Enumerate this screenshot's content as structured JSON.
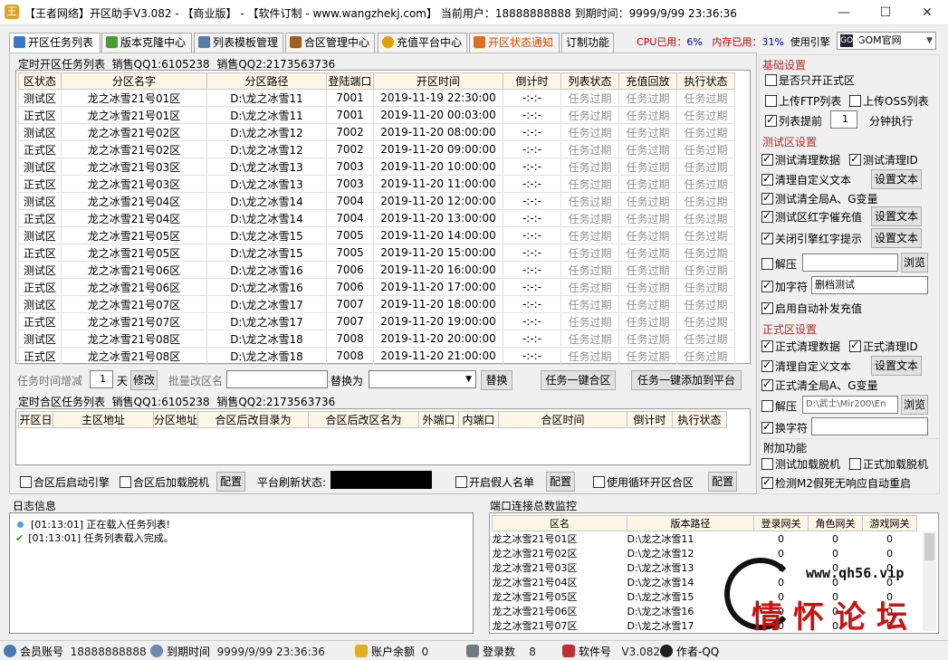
{
  "window": {
    "title": "【王者网络】开区助手V3.082 - 【商业版】 - 【软件订制 - www.wangzhekj.com】 当前用户：18888888888  到期时间：9999/9/99 23:36:36",
    "min": "—",
    "max": "☐",
    "close": "✕"
  },
  "tabs": [
    {
      "label": "开区任务列表",
      "icon": "calendar-icon",
      "color": "#3a78c8"
    },
    {
      "label": "版本克隆中心",
      "icon": "clone-icon",
      "color": "#4a9a3a"
    },
    {
      "label": "列表模板管理",
      "icon": "list-icon",
      "color": "#5a7aa8"
    },
    {
      "label": "合区管理中心",
      "icon": "merge-icon",
      "color": "#a06020"
    },
    {
      "label": "充值平台中心",
      "icon": "coin-icon",
      "color": "#e0a000"
    },
    {
      "label": "开区状态通知",
      "icon": "notify-icon",
      "color": "#e07020"
    },
    {
      "label": "订制功能",
      "icon": "",
      "color": ""
    }
  ],
  "topright": {
    "cpu_label": "CPU已用：",
    "cpu": "6%",
    "mem_label": "内存已用：",
    "mem": "31%",
    "engine_label": "使用引擎",
    "engine": "GOM官网",
    "engine_icon": "GOM"
  },
  "task": {
    "group": "定时开区任务列表",
    "qq1": "销售QQ1:6105238",
    "qq2": "销售QQ2:2173563736",
    "headers": [
      "区状态",
      "分区名字",
      "分区路径",
      "登陆端口",
      "开区时间",
      "倒计时",
      "列表状态",
      "充值回放",
      "执行状态"
    ],
    "rows": [
      [
        "测试区",
        "龙之冰雪21号01区",
        "D:\\龙之冰雪11",
        "7001",
        "2019-11-19 22:30:00",
        "-:-:-",
        "任务过期",
        "任务过期",
        "任务过期"
      ],
      [
        "正式区",
        "龙之冰雪21号01区",
        "D:\\龙之冰雪11",
        "7001",
        "2019-11-20 00:03:00",
        "-:-:-",
        "任务过期",
        "任务过期",
        "任务过期"
      ],
      [
        "测试区",
        "龙之冰雪21号02区",
        "D:\\龙之冰雪12",
        "7002",
        "2019-11-20 08:00:00",
        "-:-:-",
        "任务过期",
        "任务过期",
        "任务过期"
      ],
      [
        "正式区",
        "龙之冰雪21号02区",
        "D:\\龙之冰雪12",
        "7002",
        "2019-11-20 09:00:00",
        "-:-:-",
        "任务过期",
        "任务过期",
        "任务过期"
      ],
      [
        "测试区",
        "龙之冰雪21号03区",
        "D:\\龙之冰雪13",
        "7003",
        "2019-11-20 10:00:00",
        "-:-:-",
        "任务过期",
        "任务过期",
        "任务过期"
      ],
      [
        "正式区",
        "龙之冰雪21号03区",
        "D:\\龙之冰雪13",
        "7003",
        "2019-11-20 11:00:00",
        "-:-:-",
        "任务过期",
        "任务过期",
        "任务过期"
      ],
      [
        "测试区",
        "龙之冰雪21号04区",
        "D:\\龙之冰雪14",
        "7004",
        "2019-11-20 12:00:00",
        "-:-:-",
        "任务过期",
        "任务过期",
        "任务过期"
      ],
      [
        "正式区",
        "龙之冰雪21号04区",
        "D:\\龙之冰雪14",
        "7004",
        "2019-11-20 13:00:00",
        "-:-:-",
        "任务过期",
        "任务过期",
        "任务过期"
      ],
      [
        "测试区",
        "龙之冰雪21号05区",
        "D:\\龙之冰雪15",
        "7005",
        "2019-11-20 14:00:00",
        "-:-:-",
        "任务过期",
        "任务过期",
        "任务过期"
      ],
      [
        "正式区",
        "龙之冰雪21号05区",
        "D:\\龙之冰雪15",
        "7005",
        "2019-11-20 15:00:00",
        "-:-:-",
        "任务过期",
        "任务过期",
        "任务过期"
      ],
      [
        "测试区",
        "龙之冰雪21号06区",
        "D:\\龙之冰雪16",
        "7006",
        "2019-11-20 16:00:00",
        "-:-:-",
        "任务过期",
        "任务过期",
        "任务过期"
      ],
      [
        "正式区",
        "龙之冰雪21号06区",
        "D:\\龙之冰雪16",
        "7006",
        "2019-11-20 17:00:00",
        "-:-:-",
        "任务过期",
        "任务过期",
        "任务过期"
      ],
      [
        "测试区",
        "龙之冰雪21号07区",
        "D:\\龙之冰雪17",
        "7007",
        "2019-11-20 18:00:00",
        "-:-:-",
        "任务过期",
        "任务过期",
        "任务过期"
      ],
      [
        "正式区",
        "龙之冰雪21号07区",
        "D:\\龙之冰雪17",
        "7007",
        "2019-11-20 19:00:00",
        "-:-:-",
        "任务过期",
        "任务过期",
        "任务过期"
      ],
      [
        "测试区",
        "龙之冰雪21号08区",
        "D:\\龙之冰雪18",
        "7008",
        "2019-11-20 20:00:00",
        "-:-:-",
        "任务过期",
        "任务过期",
        "任务过期"
      ],
      [
        "正式区",
        "龙之冰雪21号08区",
        "D:\\龙之冰雪18",
        "7008",
        "2019-11-20 21:00:00",
        "-:-:-",
        "任务过期",
        "任务过期",
        "任务过期"
      ]
    ]
  },
  "toolbar": {
    "time_label": "任务时间增减",
    "days": "1",
    "day_unit": "天",
    "modify": "修改",
    "batch_label": "批量改区名",
    "replace_with": "替换为",
    "replace": "替换",
    "merge_all": "任务一键合区",
    "add_platform": "任务一键添加到平台"
  },
  "merge": {
    "group": "定时合区任务列表",
    "qq1": "销售QQ1:6105238",
    "qq2": "销售QQ2:2173563736",
    "headers": [
      "开区日",
      "主区地址",
      "分区地址",
      "合区后改目录为",
      "合区后改区名为",
      "外端口",
      "内端口",
      "合区时间",
      "倒计时",
      "执行状态"
    ]
  },
  "merge_opts": {
    "restart_engine": "合区后启动引擎",
    "load_offline": "合区后加载脱机",
    "config": "配置",
    "refresh_label": "平台刷新状态:",
    "fake_list": "开启假人名单",
    "config2": "配置",
    "loop_merge": "使用循环开区合区",
    "config3": "配置"
  },
  "settings": {
    "basic_title": "基础设置",
    "only_formal": "是否只开正式区",
    "upload_ftp": "上传FTP列表",
    "upload_oss": "上传OSS列表",
    "list_ahead": "列表提前",
    "ahead_value": "1",
    "ahead_unit": "分钟执行",
    "test_title": "测试区设置",
    "test_clear_data": "测试清理数据",
    "test_clear_id": "测试清理ID",
    "clear_custom": "清理自定义文本",
    "set_text": "设置文本",
    "test_clear_ag": "测试清全局A、G变量",
    "test_red": "测试区红字催充值",
    "close_red": "关闭引擎红字提示",
    "unzip": "解压",
    "browse": "浏览",
    "add_char": "加字符",
    "add_char_val": "删档测试",
    "auto_recharge": "启用自动补发充值",
    "formal_title": "正式区设置",
    "formal_clear_data": "正式清理数据",
    "formal_clear_id": "正式清理ID",
    "formal_clear_custom": "清理自定义文本",
    "formal_clear_ag": "正式清全局A、G变量",
    "unzip_path": "D:\\武士\\Mir200\\En",
    "replace_char": "换字符",
    "extra_title": "附加功能",
    "test_load_offline": "测试加载脱机",
    "formal_load_offline": "正式加载脱机",
    "detect_m2": "检测M2假死无响应自动重启"
  },
  "log": {
    "title": "日志信息",
    "lines": [
      {
        "time": "[01:13:01]",
        "text": "正在载入任务列表!"
      },
      {
        "time": "[01:13:01]",
        "text": "任务列表载入完成。"
      }
    ]
  },
  "monitor": {
    "title": "端口连接总数监控",
    "headers": [
      "区名",
      "版本路径",
      "登录网关",
      "角色网关",
      "游戏网关"
    ],
    "rows": [
      [
        "龙之冰雪21号01区",
        "D:\\龙之冰雪11",
        "0",
        "0",
        "0"
      ],
      [
        "龙之冰雪21号02区",
        "D:\\龙之冰雪12",
        "0",
        "0",
        "0"
      ],
      [
        "龙之冰雪21号03区",
        "D:\\龙之冰雪13",
        "0",
        "0",
        "0"
      ],
      [
        "龙之冰雪21号04区",
        "D:\\龙之冰雪14",
        "0",
        "0",
        "0"
      ],
      [
        "龙之冰雪21号05区",
        "D:\\龙之冰雪15",
        "0",
        "0",
        "0"
      ],
      [
        "龙之冰雪21号06区",
        "D:\\龙之冰雪16",
        "0",
        "0",
        "0"
      ],
      [
        "龙之冰雪21号07区",
        "D:\\龙之冰雪17",
        "0",
        "0",
        "0"
      ]
    ]
  },
  "watermark": {
    "url": "www.qh56.vip",
    "name": "情怀论坛"
  },
  "status": {
    "account_label": "会员账号",
    "account": "18888888888",
    "expire_label": "到期时间",
    "expire": "9999/9/99 23:36:36",
    "balance_label": "账户余额",
    "balance": "0",
    "logins_label": "登录数",
    "logins": "8",
    "version_label": "软件号",
    "version": "V3.082",
    "author_label": "作者-QQ"
  }
}
